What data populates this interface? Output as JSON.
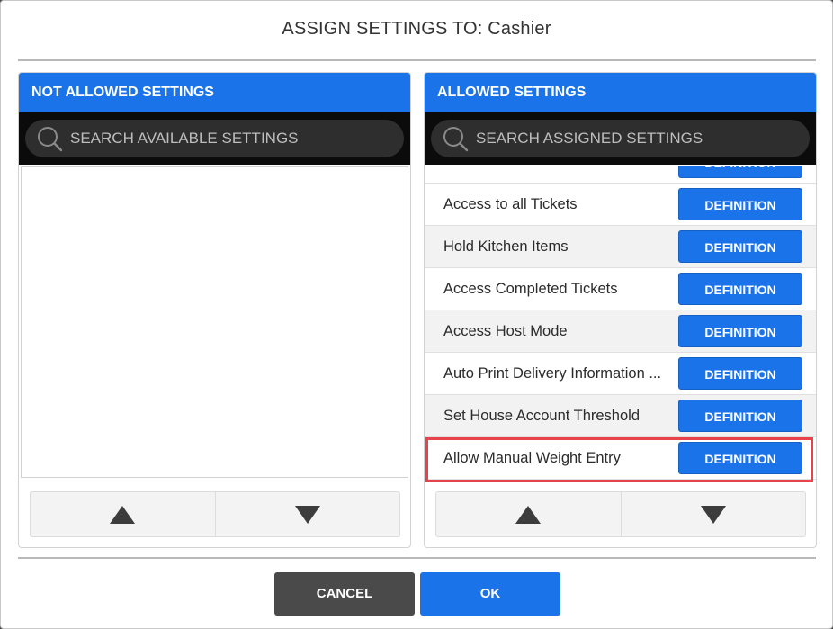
{
  "dialog": {
    "title": "ASSIGN SETTINGS TO: Cashier"
  },
  "left_panel": {
    "header": "NOT ALLOWED SETTINGS",
    "search_placeholder": "SEARCH AVAILABLE SETTINGS",
    "items": []
  },
  "right_panel": {
    "header": "ALLOWED SETTINGS",
    "search_placeholder": "SEARCH ASSIGNED SETTINGS",
    "definition_label": "DEFINITION",
    "items": [
      {
        "label": "Access to all Tickets"
      },
      {
        "label": "Hold Kitchen Items"
      },
      {
        "label": "Access Completed Tickets"
      },
      {
        "label": "Access Host Mode"
      },
      {
        "label": "Auto Print Delivery Information ..."
      },
      {
        "label": "Set House Account Threshold"
      },
      {
        "label": "Allow Manual Weight Entry",
        "highlighted": true
      }
    ]
  },
  "footer": {
    "cancel_label": "CANCEL",
    "ok_label": "OK"
  },
  "colors": {
    "accent": "#1a73e8",
    "search_bar": "#0b0b0b",
    "cancel": "#4a4a4a",
    "highlight": "#e8434a"
  },
  "icons": {
    "search": "search-icon",
    "up": "triangle-up-icon",
    "down": "triangle-down-icon"
  }
}
